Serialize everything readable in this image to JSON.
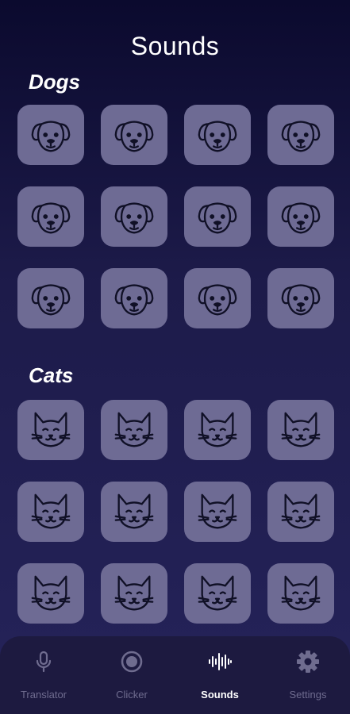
{
  "header": {
    "title": "Sounds"
  },
  "sections": [
    {
      "label": "Dogs",
      "items": [
        {
          "icon": "dog-face-icon"
        },
        {
          "icon": "dog-face-icon"
        },
        {
          "icon": "dog-face-icon"
        },
        {
          "icon": "dog-face-icon"
        },
        {
          "icon": "dog-face-icon"
        },
        {
          "icon": "dog-face-icon"
        },
        {
          "icon": "dog-face-icon"
        },
        {
          "icon": "dog-face-icon"
        },
        {
          "icon": "dog-face-icon"
        },
        {
          "icon": "dog-face-icon"
        },
        {
          "icon": "dog-face-icon"
        },
        {
          "icon": "dog-face-icon"
        }
      ]
    },
    {
      "label": "Cats",
      "items": [
        {
          "icon": "cat-face-icon"
        },
        {
          "icon": "cat-face-icon"
        },
        {
          "icon": "cat-face-icon"
        },
        {
          "icon": "cat-face-icon"
        },
        {
          "icon": "cat-face-icon"
        },
        {
          "icon": "cat-face-icon"
        },
        {
          "icon": "cat-face-icon"
        },
        {
          "icon": "cat-face-icon"
        },
        {
          "icon": "cat-face-icon"
        },
        {
          "icon": "cat-face-icon"
        },
        {
          "icon": "cat-face-icon"
        },
        {
          "icon": "cat-face-icon"
        }
      ]
    }
  ],
  "nav": {
    "items": [
      {
        "label": "Translator",
        "icon": "microphone-icon"
      },
      {
        "label": "Clicker",
        "icon": "clicker-icon"
      },
      {
        "label": "Sounds",
        "icon": "sound-wave-icon",
        "active": true
      },
      {
        "label": "Settings",
        "icon": "gear-icon"
      }
    ]
  },
  "colors": {
    "tile": "#6e6b94",
    "nav_bg": "#1d1a40",
    "nav_inactive": "#6f6c8f",
    "nav_active": "#ffffff"
  }
}
